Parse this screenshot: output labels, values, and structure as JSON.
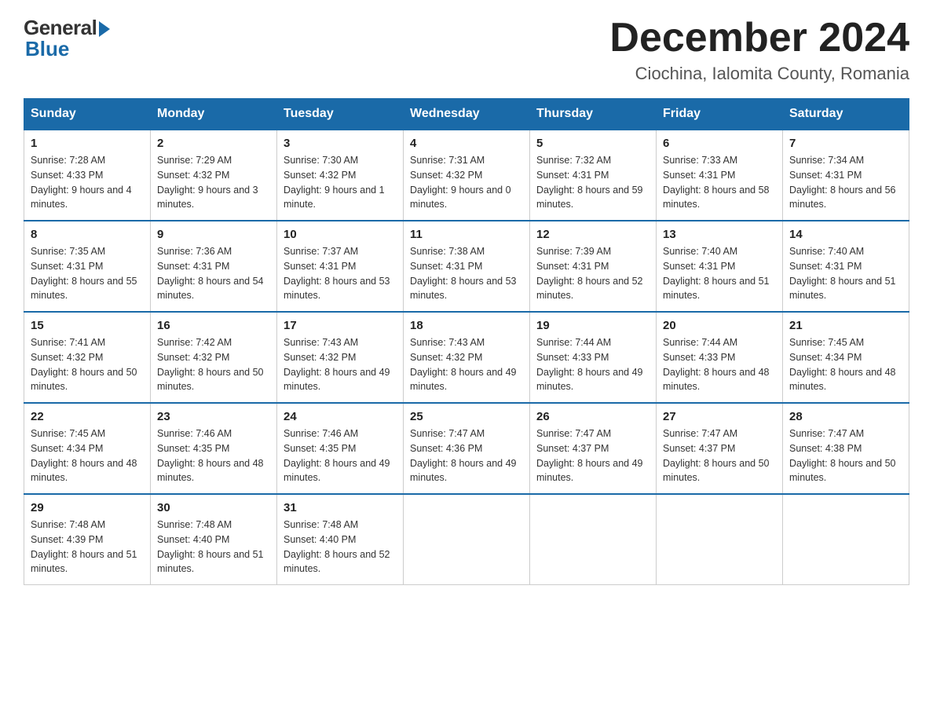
{
  "header": {
    "logo_general": "General",
    "logo_blue": "Blue",
    "month_title": "December 2024",
    "location": "Ciochina, Ialomita County, Romania"
  },
  "days_of_week": [
    "Sunday",
    "Monday",
    "Tuesday",
    "Wednesday",
    "Thursday",
    "Friday",
    "Saturday"
  ],
  "weeks": [
    [
      {
        "day": "1",
        "sunrise": "Sunrise: 7:28 AM",
        "sunset": "Sunset: 4:33 PM",
        "daylight": "Daylight: 9 hours and 4 minutes."
      },
      {
        "day": "2",
        "sunrise": "Sunrise: 7:29 AM",
        "sunset": "Sunset: 4:32 PM",
        "daylight": "Daylight: 9 hours and 3 minutes."
      },
      {
        "day": "3",
        "sunrise": "Sunrise: 7:30 AM",
        "sunset": "Sunset: 4:32 PM",
        "daylight": "Daylight: 9 hours and 1 minute."
      },
      {
        "day": "4",
        "sunrise": "Sunrise: 7:31 AM",
        "sunset": "Sunset: 4:32 PM",
        "daylight": "Daylight: 9 hours and 0 minutes."
      },
      {
        "day": "5",
        "sunrise": "Sunrise: 7:32 AM",
        "sunset": "Sunset: 4:31 PM",
        "daylight": "Daylight: 8 hours and 59 minutes."
      },
      {
        "day": "6",
        "sunrise": "Sunrise: 7:33 AM",
        "sunset": "Sunset: 4:31 PM",
        "daylight": "Daylight: 8 hours and 58 minutes."
      },
      {
        "day": "7",
        "sunrise": "Sunrise: 7:34 AM",
        "sunset": "Sunset: 4:31 PM",
        "daylight": "Daylight: 8 hours and 56 minutes."
      }
    ],
    [
      {
        "day": "8",
        "sunrise": "Sunrise: 7:35 AM",
        "sunset": "Sunset: 4:31 PM",
        "daylight": "Daylight: 8 hours and 55 minutes."
      },
      {
        "day": "9",
        "sunrise": "Sunrise: 7:36 AM",
        "sunset": "Sunset: 4:31 PM",
        "daylight": "Daylight: 8 hours and 54 minutes."
      },
      {
        "day": "10",
        "sunrise": "Sunrise: 7:37 AM",
        "sunset": "Sunset: 4:31 PM",
        "daylight": "Daylight: 8 hours and 53 minutes."
      },
      {
        "day": "11",
        "sunrise": "Sunrise: 7:38 AM",
        "sunset": "Sunset: 4:31 PM",
        "daylight": "Daylight: 8 hours and 53 minutes."
      },
      {
        "day": "12",
        "sunrise": "Sunrise: 7:39 AM",
        "sunset": "Sunset: 4:31 PM",
        "daylight": "Daylight: 8 hours and 52 minutes."
      },
      {
        "day": "13",
        "sunrise": "Sunrise: 7:40 AM",
        "sunset": "Sunset: 4:31 PM",
        "daylight": "Daylight: 8 hours and 51 minutes."
      },
      {
        "day": "14",
        "sunrise": "Sunrise: 7:40 AM",
        "sunset": "Sunset: 4:31 PM",
        "daylight": "Daylight: 8 hours and 51 minutes."
      }
    ],
    [
      {
        "day": "15",
        "sunrise": "Sunrise: 7:41 AM",
        "sunset": "Sunset: 4:32 PM",
        "daylight": "Daylight: 8 hours and 50 minutes."
      },
      {
        "day": "16",
        "sunrise": "Sunrise: 7:42 AM",
        "sunset": "Sunset: 4:32 PM",
        "daylight": "Daylight: 8 hours and 50 minutes."
      },
      {
        "day": "17",
        "sunrise": "Sunrise: 7:43 AM",
        "sunset": "Sunset: 4:32 PM",
        "daylight": "Daylight: 8 hours and 49 minutes."
      },
      {
        "day": "18",
        "sunrise": "Sunrise: 7:43 AM",
        "sunset": "Sunset: 4:32 PM",
        "daylight": "Daylight: 8 hours and 49 minutes."
      },
      {
        "day": "19",
        "sunrise": "Sunrise: 7:44 AM",
        "sunset": "Sunset: 4:33 PM",
        "daylight": "Daylight: 8 hours and 49 minutes."
      },
      {
        "day": "20",
        "sunrise": "Sunrise: 7:44 AM",
        "sunset": "Sunset: 4:33 PM",
        "daylight": "Daylight: 8 hours and 48 minutes."
      },
      {
        "day": "21",
        "sunrise": "Sunrise: 7:45 AM",
        "sunset": "Sunset: 4:34 PM",
        "daylight": "Daylight: 8 hours and 48 minutes."
      }
    ],
    [
      {
        "day": "22",
        "sunrise": "Sunrise: 7:45 AM",
        "sunset": "Sunset: 4:34 PM",
        "daylight": "Daylight: 8 hours and 48 minutes."
      },
      {
        "day": "23",
        "sunrise": "Sunrise: 7:46 AM",
        "sunset": "Sunset: 4:35 PM",
        "daylight": "Daylight: 8 hours and 48 minutes."
      },
      {
        "day": "24",
        "sunrise": "Sunrise: 7:46 AM",
        "sunset": "Sunset: 4:35 PM",
        "daylight": "Daylight: 8 hours and 49 minutes."
      },
      {
        "day": "25",
        "sunrise": "Sunrise: 7:47 AM",
        "sunset": "Sunset: 4:36 PM",
        "daylight": "Daylight: 8 hours and 49 minutes."
      },
      {
        "day": "26",
        "sunrise": "Sunrise: 7:47 AM",
        "sunset": "Sunset: 4:37 PM",
        "daylight": "Daylight: 8 hours and 49 minutes."
      },
      {
        "day": "27",
        "sunrise": "Sunrise: 7:47 AM",
        "sunset": "Sunset: 4:37 PM",
        "daylight": "Daylight: 8 hours and 50 minutes."
      },
      {
        "day": "28",
        "sunrise": "Sunrise: 7:47 AM",
        "sunset": "Sunset: 4:38 PM",
        "daylight": "Daylight: 8 hours and 50 minutes."
      }
    ],
    [
      {
        "day": "29",
        "sunrise": "Sunrise: 7:48 AM",
        "sunset": "Sunset: 4:39 PM",
        "daylight": "Daylight: 8 hours and 51 minutes."
      },
      {
        "day": "30",
        "sunrise": "Sunrise: 7:48 AM",
        "sunset": "Sunset: 4:40 PM",
        "daylight": "Daylight: 8 hours and 51 minutes."
      },
      {
        "day": "31",
        "sunrise": "Sunrise: 7:48 AM",
        "sunset": "Sunset: 4:40 PM",
        "daylight": "Daylight: 8 hours and 52 minutes."
      },
      null,
      null,
      null,
      null
    ]
  ]
}
